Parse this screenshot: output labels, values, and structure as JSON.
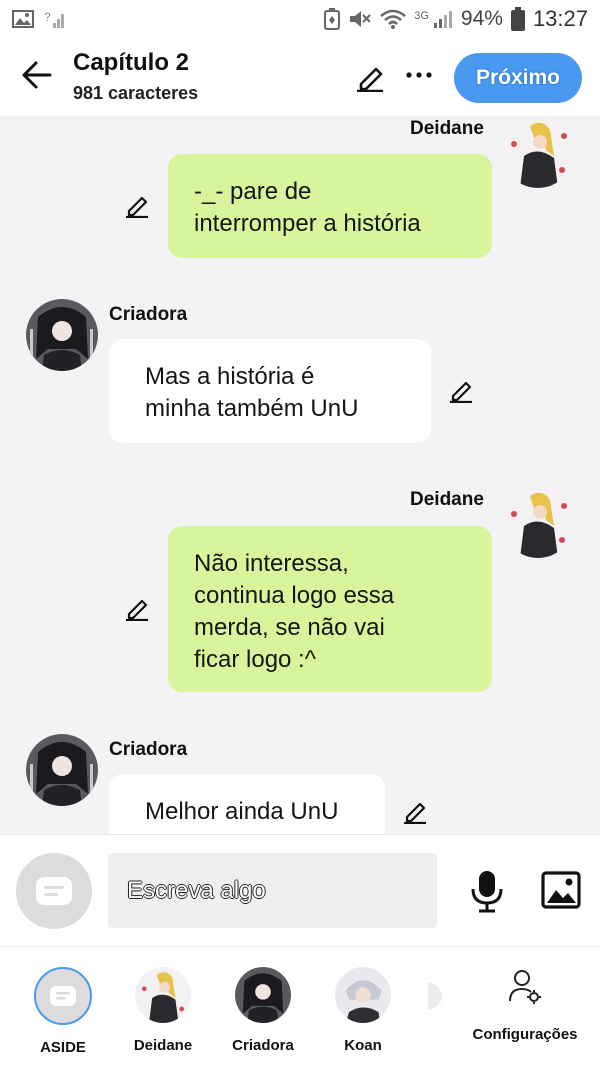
{
  "status_bar": {
    "battery_percent": "94%",
    "time": "13:27",
    "network_label": "3G"
  },
  "header": {
    "title": "Capítulo 2",
    "subtitle": "981 caracteres",
    "next_label": "Próximo"
  },
  "messages": [
    {
      "side": "right",
      "author": "Deidane",
      "avatar": "deidane",
      "lines": [
        "-_- pare de",
        "interromper a história"
      ]
    },
    {
      "side": "left",
      "author": "Criadora",
      "avatar": "criadora",
      "lines": [
        "Mas a história é",
        "minha também UnU"
      ]
    },
    {
      "side": "right",
      "author": "Deidane",
      "avatar": "deidane",
      "lines": [
        "Não interessa,",
        "continua logo essa",
        "merda, se não vai",
        "ficar logo :^"
      ]
    },
    {
      "side": "left",
      "author": "Criadora",
      "avatar": "criadora",
      "lines": [
        "Melhor ainda UnU"
      ]
    }
  ],
  "input": {
    "placeholder": "Escreva algo"
  },
  "characters": [
    {
      "name": "ASIDE"
    },
    {
      "name": "Deidane"
    },
    {
      "name": "Criadora"
    },
    {
      "name": "Koan"
    }
  ],
  "settings_label": "Configurações",
  "colors": {
    "accent": "#4a98f0",
    "bubble_right": "#d9f59c",
    "bubble_left": "#ffffff",
    "background": "#f3f3f5"
  },
  "icons": {
    "back": "arrow-left-icon",
    "edit": "pencil-icon",
    "more": "more-dots-icon",
    "mic": "microphone-icon",
    "image": "image-icon",
    "settings": "user-gear-icon"
  }
}
